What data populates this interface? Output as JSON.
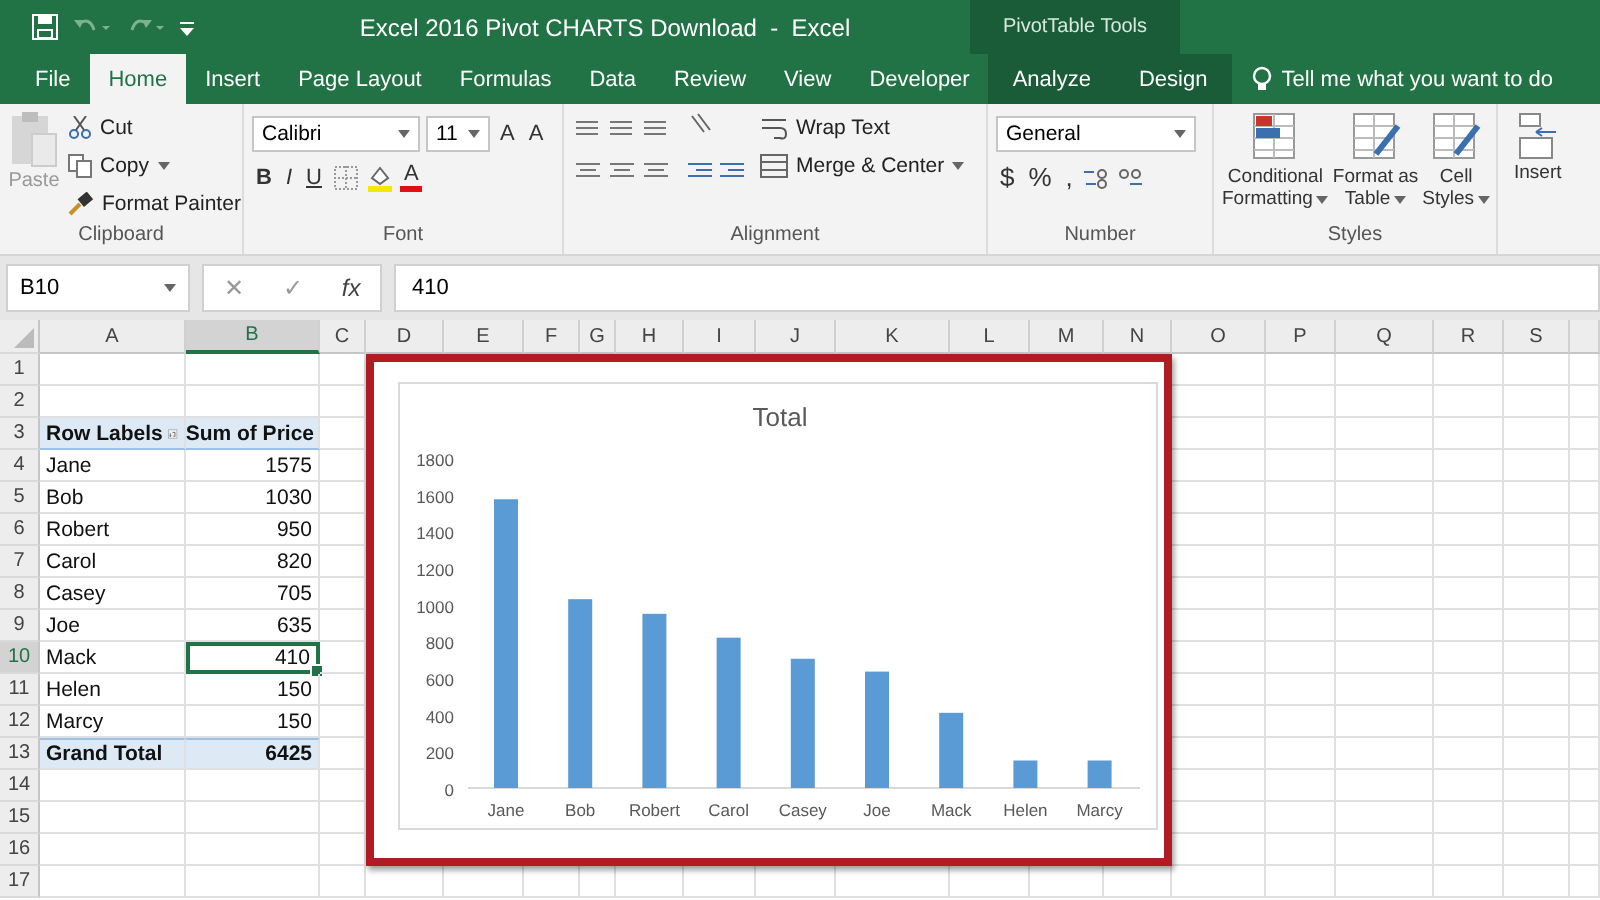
{
  "window": {
    "title": "Excel 2016 Pivot CHARTS Download  -  Excel",
    "context_title": "PivotTable Tools"
  },
  "tabs": [
    {
      "label": "File",
      "selected": false,
      "contextual": false
    },
    {
      "label": "Home",
      "selected": true,
      "contextual": false
    },
    {
      "label": "Insert",
      "selected": false,
      "contextual": false
    },
    {
      "label": "Page Layout",
      "selected": false,
      "contextual": false
    },
    {
      "label": "Formulas",
      "selected": false,
      "contextual": false
    },
    {
      "label": "Data",
      "selected": false,
      "contextual": false
    },
    {
      "label": "Review",
      "selected": false,
      "contextual": false
    },
    {
      "label": "View",
      "selected": false,
      "contextual": false
    },
    {
      "label": "Developer",
      "selected": false,
      "contextual": false
    },
    {
      "label": "Analyze",
      "selected": false,
      "contextual": true
    },
    {
      "label": "Design",
      "selected": false,
      "contextual": true
    }
  ],
  "tell_me": {
    "placeholder": "Tell me what you want to do"
  },
  "ribbon": {
    "clipboard": {
      "label": "Clipboard",
      "paste": "Paste",
      "cut": "Cut",
      "copy": "Copy",
      "format_painter": "Format Painter"
    },
    "font": {
      "label": "Font",
      "family": "Calibri",
      "size": "11",
      "grow": "A",
      "shrink": "A",
      "bold": "B",
      "italic": "I",
      "underline": "U",
      "font_color_button": "A"
    },
    "alignment": {
      "label": "Alignment",
      "wrap": "Wrap Text",
      "merge": "Merge & Center"
    },
    "number": {
      "label": "Number",
      "format": "General",
      "currency": "$",
      "percent": "%",
      "comma": ","
    },
    "styles": {
      "label": "Styles",
      "buttons": [
        {
          "line1": "Conditional",
          "line2": "Formatting"
        },
        {
          "line1": "Format as",
          "line2": "Table"
        },
        {
          "line1": "Cell",
          "line2": "Styles"
        }
      ]
    },
    "cells": {
      "insert": "Insert"
    }
  },
  "formula_bar": {
    "name_box": "B10",
    "cancel": "✕",
    "enter": "✓",
    "function": "fx",
    "value": "410"
  },
  "sheet": {
    "columns": [
      "A",
      "B",
      "C",
      "D",
      "E",
      "F",
      "G",
      "H",
      "I",
      "J",
      "K",
      "L",
      "M",
      "N",
      "O",
      "P",
      "Q",
      "R",
      "S"
    ],
    "row_numbers": [
      "1",
      "2",
      "3",
      "4",
      "5",
      "6",
      "7",
      "8",
      "9",
      "10",
      "11",
      "12",
      "13",
      "14",
      "15",
      "16",
      "17"
    ],
    "pivot": {
      "header": [
        "Row Labels",
        "Sum of Price"
      ],
      "rows": [
        {
          "label": "Jane",
          "value": "1575",
          "selected": false
        },
        {
          "label": "Bob",
          "value": "1030",
          "selected": false
        },
        {
          "label": "Robert",
          "value": "950",
          "selected": false
        },
        {
          "label": "Carol",
          "value": "820",
          "selected": false
        },
        {
          "label": "Casey",
          "value": "705",
          "selected": false
        },
        {
          "label": "Joe",
          "value": "635",
          "selected": false
        },
        {
          "label": "Mack",
          "value": "410",
          "selected": true
        },
        {
          "label": "Helen",
          "value": "150",
          "selected": false
        },
        {
          "label": "Marcy",
          "value": "150",
          "selected": false
        }
      ],
      "total": {
        "label": "Grand Total",
        "value": "6425"
      }
    }
  },
  "chart_data": {
    "type": "bar",
    "title": "Total",
    "categories": [
      "Jane",
      "Bob",
      "Robert",
      "Carol",
      "Casey",
      "Joe",
      "Mack",
      "Helen",
      "Marcy"
    ],
    "series": [
      {
        "color": "#5b9bd5",
        "values": [
          1575,
          1030,
          950,
          820,
          705,
          635,
          410,
          150,
          150
        ]
      }
    ],
    "ylim": [
      0,
      1800
    ],
    "yticks": [
      0,
      200,
      400,
      600,
      800,
      1000,
      1200,
      1400,
      1600,
      1800
    ]
  }
}
